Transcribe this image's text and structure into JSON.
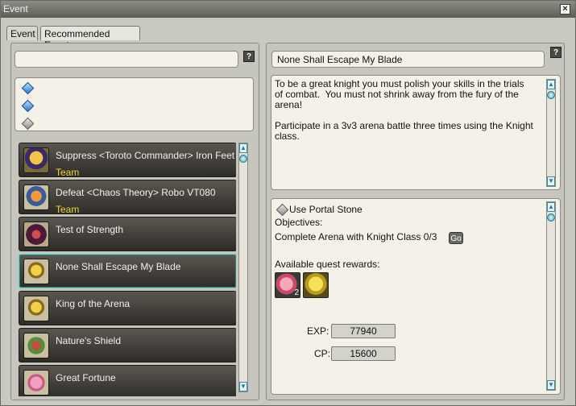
{
  "window": {
    "title": "Event"
  },
  "tabs": [
    {
      "label": "Event"
    },
    {
      "label": "Recommended Event"
    }
  ],
  "left": {
    "search_value": "",
    "help_label": "?",
    "quests": [
      {
        "name": "Suppress <Toroto Commander> Iron Feet",
        "tag": "Team",
        "icon": "commander-icon"
      },
      {
        "name": "Defeat <Chaos Theory> Robo VT080",
        "tag": "Team",
        "icon": "robot-icon"
      },
      {
        "name": "Test of Strength",
        "tag": "",
        "icon": "monster-icon"
      },
      {
        "name": "None Shall Escape My Blade",
        "tag": "",
        "icon": "trophy-icon"
      },
      {
        "name": "King of the Arena",
        "tag": "",
        "icon": "trophy-icon"
      },
      {
        "name": "Nature's Shield",
        "tag": "",
        "icon": "shield-leaf-icon"
      },
      {
        "name": "Great Fortune",
        "tag": "",
        "icon": "orb-icon"
      }
    ]
  },
  "right": {
    "quest_title": "None Shall Escape My Blade",
    "help_label": "?",
    "description": "To be a great knight you must polish your skills in the trials\nof combat.  You must not shrink away from the fury of the\narena!\n\nParticipate in a 3v3 arena battle three times using the Knight\nclass.",
    "portal_label": "Use Portal Stone",
    "objectives_label": "Objectives:",
    "objective": "Complete Arena with Knight Class 0/3",
    "go_label": "Go",
    "rewards_label": "Available quest rewards:",
    "rewards": [
      {
        "icon": "feather-icon",
        "count": "2"
      },
      {
        "icon": "shield-icon",
        "count": ""
      }
    ],
    "exp_label": "EXP:",
    "exp_value": "77940",
    "cp_label": "CP:",
    "cp_value": "15600"
  },
  "colors": {
    "tag": "#f3d23a",
    "selected_border": "#5fd8c8"
  }
}
